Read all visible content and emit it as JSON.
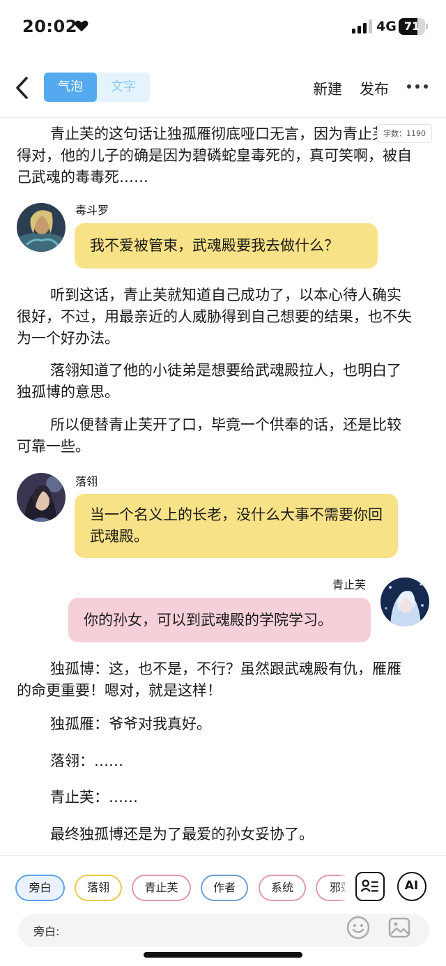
{
  "status_bar": {
    "time": "20:02",
    "network": "4G",
    "battery": "71",
    "battery_level": 0.71
  },
  "toolbar": {
    "mode_tabs": [
      "气泡",
      "文字"
    ],
    "new_label": "新建",
    "publish_label": "发布"
  },
  "editor": {
    "word_count": "字数：1190",
    "paragraphs": [
      "青止芙的这句话让独孤雁彻底哑口无言，因为青止芙说得对，他的儿子的确是因为碧磷蛇皇毒死的，真可笑啊，被自己武魂的毒毒死……",
      "听到这话，青止芙就知道自己成功了，以本心待人确实很好，不过，用最亲近的人威胁得到自己想要的结果，也不失为一个好办法。",
      "落翎知道了他的小徒弟是想要给武魂殿拉人，也明白了独孤博的意思。",
      "所以便替青止芙开了口，毕竟一个供奉的话，还是比较可靠一些。",
      "独孤博：这，也不是，不行？虽然跟武魂殿有仇，雁雁的命更重要！嗯对，就是这样！",
      "独孤雁：爷爷对我真好。",
      "落翎：……",
      "青止芙：……",
      "最终独孤博还是为了最爱的孙女妥协了。"
    ],
    "bubbles": [
      {
        "speaker": "毒斗罗",
        "text": "我不爱被管束，武魂殿要我去做什么？"
      },
      {
        "speaker": "落翎",
        "text": "当一个名义上的长老，没什么大事不需要你回武魂殿。"
      },
      {
        "speaker": "青止芙",
        "text": "你的孙女，可以到武魂殿的学院学习。"
      }
    ]
  },
  "bottom_panel": {
    "roles": [
      "旁白",
      "落翎",
      "青止芙",
      "作者",
      "系统",
      "邪莲"
    ],
    "ai_label": "AI",
    "input_prefix": "旁白:",
    "input_value": ""
  },
  "colors": {
    "accent": "#55a9ee",
    "yellow_bubble": "#f8e287",
    "pink_bubble": "#f6d0d9",
    "chip_border_yellow": "#e8c84a",
    "chip_border_pink": "#e39aab",
    "chip_border_blue": "#6f9fd6"
  },
  "icons": {
    "status": [
      "heart-icon",
      "signal-icon",
      "battery-icon"
    ],
    "toolbar": [
      "back-icon",
      "more-icon"
    ],
    "bottom": [
      "contact-card-icon",
      "emoji-icon",
      "image-icon"
    ]
  }
}
